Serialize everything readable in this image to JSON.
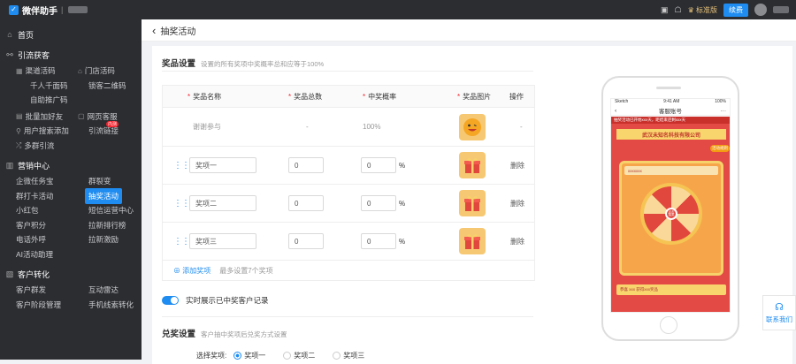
{
  "topbar": {
    "brand": "微伴助手",
    "brand_sep": "|",
    "version": "标准版",
    "renew": "续费"
  },
  "sidebar": {
    "home": "首页",
    "lead_section": "引流获客",
    "lead_items": [
      [
        "渠道活码",
        "门店活码"
      ],
      [
        "千人千面码",
        "锁客二维码"
      ],
      [
        "自助推广码",
        ""
      ]
    ],
    "lead_items2": [
      [
        "批量加好友",
        "网页客服"
      ],
      [
        "用户搜索添加",
        "引流链接"
      ],
      [
        "多群引流",
        ""
      ]
    ],
    "new_badge": "内测",
    "marketing_section": "营销中心",
    "marketing_items": [
      [
        "企微任务宝",
        "群裂变"
      ],
      [
        "群打卡活动",
        "抽奖活动"
      ],
      [
        "小红包",
        "短信运营中心"
      ],
      [
        "客户积分",
        "拉新排行榜"
      ],
      [
        "电话外呼",
        "拉新激励"
      ],
      [
        "AI活动助理",
        ""
      ]
    ],
    "conversion_section": "客户转化",
    "conversion_items": [
      [
        "客户群发",
        "互动雷达"
      ],
      [
        "客户阶段管理",
        "手机线索转化"
      ]
    ]
  },
  "breadcrumb": {
    "back_icon": "‹",
    "title": "抽奖活动"
  },
  "prize_settings": {
    "title": "奖品设置",
    "desc": "设置的所有奖项中奖概率总和应等于100%",
    "columns": [
      "奖品名称",
      "奖品总数",
      "中奖概率",
      "奖品图片",
      "操作"
    ],
    "thanks_row": {
      "name": "谢谢参与",
      "count": "-",
      "rate": "100%",
      "op": "-"
    },
    "rows": [
      {
        "name": "奖项一",
        "count": "0",
        "rate": "0",
        "unit": "%",
        "op": "删除"
      },
      {
        "name": "奖项二",
        "count": "0",
        "rate": "0",
        "unit": "%",
        "op": "删除"
      },
      {
        "name": "奖项三",
        "count": "0",
        "rate": "0",
        "unit": "%",
        "op": "删除"
      }
    ],
    "add_label": "⊕ 添加奖项",
    "add_hint": "最多设置7个奖项"
  },
  "realtime_toggle": {
    "label": "实时展示已中奖客户记录",
    "on": true
  },
  "redeem_settings": {
    "title": "兑奖设置",
    "desc": "客户抽中奖项后兑奖方式设置",
    "select_label": "选择奖项:",
    "options": [
      "奖项一",
      "奖项二",
      "奖项三"
    ]
  },
  "phone_preview": {
    "status_left": "Sketch",
    "status_time": "9:41 AM",
    "status_right": "100%",
    "nav_title": "客服账号",
    "notice": "抽奖活动已开始xxx天，距结束还剩xxx天",
    "company": "武汉未知名科技有限公司",
    "rules": "活动规则",
    "panel_text": "xxxxxxx",
    "center_text": "点击抽奖",
    "footer_text": "恭喜 xxx 获得xxx奖品"
  },
  "contact": {
    "label": "联系我们"
  },
  "colors": {
    "primary": "#1e8cf0",
    "sidebar_bg": "#2b2d31",
    "danger": "#f5222d"
  }
}
